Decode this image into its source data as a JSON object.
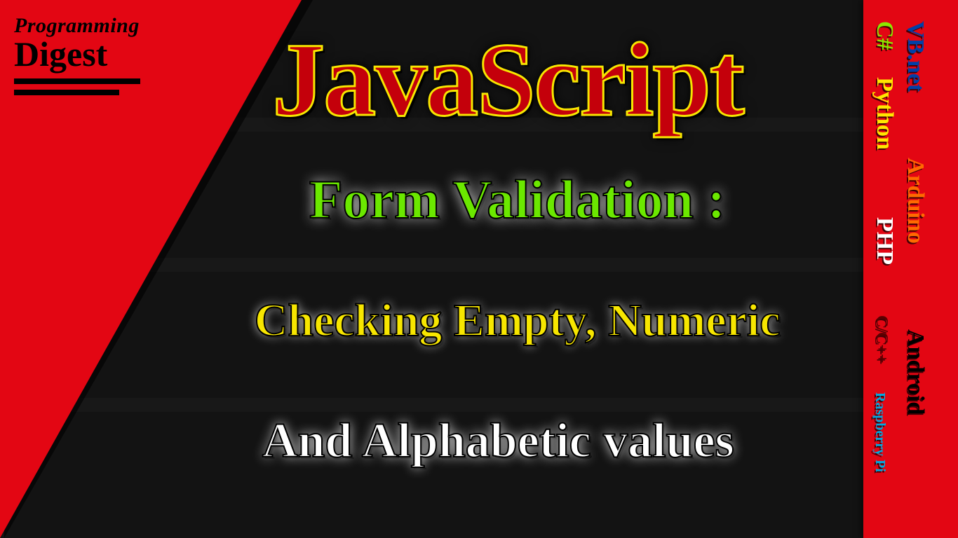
{
  "logo": {
    "line1": "Programming",
    "line2": "Digest"
  },
  "headlines": {
    "js": "JavaScript",
    "form": "Form Validation :",
    "check": "Checking Empty, Numeric",
    "alpha": "And Alphabetic values"
  },
  "langs": {
    "csharp": "C#",
    "python": "Python",
    "php": "PHP",
    "cc": "C/C++",
    "rpi": "Raspberry Pi",
    "vbnet": "VB.net",
    "arduino": "Arduino",
    "android": "Android"
  }
}
